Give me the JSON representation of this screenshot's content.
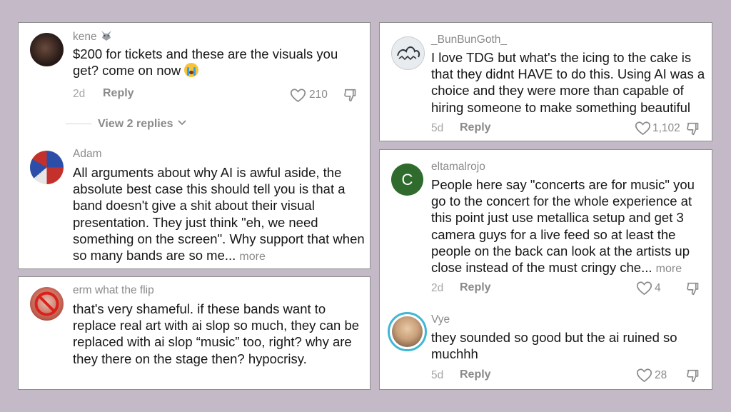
{
  "comments": [
    {
      "username": "kene",
      "text": "$200 for tickets and these are the visuals you get? come on now",
      "emoji": "😭",
      "age": "2d",
      "reply_label": "Reply",
      "likes": "210",
      "view_replies": "View 2 replies"
    },
    {
      "username": "Adam",
      "text": "All arguments about why AI is awful aside, the absolute best case this should tell you is that a band doesn't give a shit about their visual presentation. They just think \"eh, we need something on the screen\". Why support that when so many bands are so me...",
      "more_label": "more"
    },
    {
      "username": "erm what the flip",
      "text": "that's very shameful. if these bands want to replace real art with ai slop so much, they can be replaced with ai slop “music” too, right? why are they there on the stage then? hypocrisy."
    },
    {
      "username": "_BunBunGoth_",
      "text": "I love TDG but what's the icing to the cake is that they didnt HAVE to do this. Using AI was a choice and they were more than capable of hiring someone to make something beautiful",
      "age": "5d",
      "reply_label": "Reply",
      "likes": "1,102"
    },
    {
      "username": "eltamalrojo",
      "avatar_letter": "C",
      "text": "People here say \"concerts are for music\" you go to the concert for the whole experience at this point just use metallica setup and get 3 camera guys for a live feed so at least the people on the back can look at the artists up close instead of the must cringy che...",
      "more_label": "more",
      "age": "2d",
      "reply_label": "Reply",
      "likes": "4"
    },
    {
      "username": "Vye",
      "text": "they sounded so good but the ai ruined so muchhh",
      "age": "5d",
      "reply_label": "Reply",
      "likes": "28"
    }
  ],
  "colors": {
    "background": "#c3b9c7",
    "avatar_green": "#2e6b2c",
    "story_ring": "#3fb7d6"
  },
  "icons": [
    "wolf-emoji-icon",
    "loudly-crying-emoji-icon",
    "chevron-down-icon",
    "heart-icon",
    "thumbs-down-icon"
  ]
}
